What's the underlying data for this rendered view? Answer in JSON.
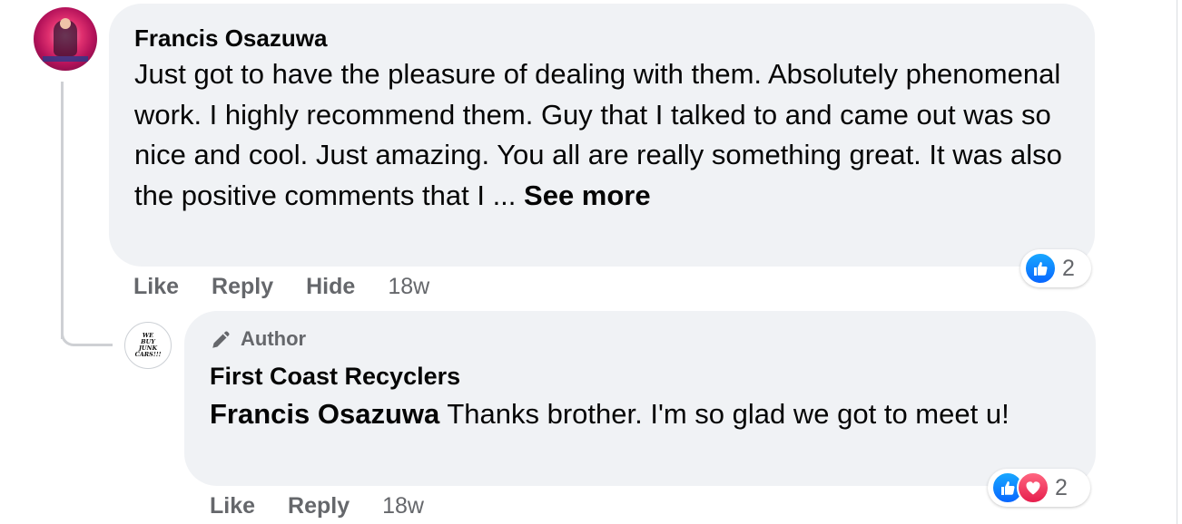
{
  "comment": {
    "author": "Francis Osazuwa",
    "text": "Just got to have the pleasure of dealing with them. Absolutely phenomenal work. I highly recommend them. Guy that I talked to and came out was so nice and cool. Just amazing. You all are really something great. It was also the positive comments that I ... ",
    "see_more": "See more",
    "actions": {
      "like": "Like",
      "reply": "Reply",
      "hide": "Hide"
    },
    "timestamp": "18w",
    "reaction_count": "2",
    "reactions": [
      "like-icon"
    ]
  },
  "reply": {
    "author_badge": "Author",
    "author": "First Coast Recyclers",
    "mention": "Francis Osazuwa",
    "text": " Thanks brother. I'm so glad we got to meet u!",
    "avatar_text": [
      "WE",
      "BUY",
      "JUNK",
      "CARS!!!"
    ],
    "actions": {
      "like": "Like",
      "reply": "Reply"
    },
    "timestamp": "18w",
    "reaction_count": "2",
    "reactions": [
      "like-icon",
      "love-icon"
    ]
  },
  "colors": {
    "bubble": "#f0f2f5",
    "secondary_text": "#65676b",
    "like_blue": "#0866ff",
    "love_red": "#e61e4d"
  }
}
